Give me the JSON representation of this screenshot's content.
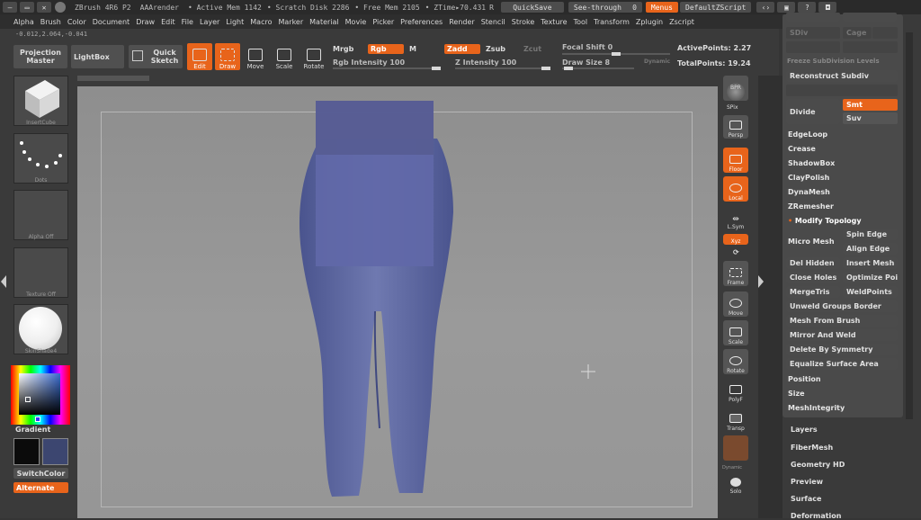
{
  "titlebar": {
    "app": "ZBrush 4R6 P2",
    "doc": "AAArender",
    "active_mem": "• Active Mem 1142",
    "scratch": "• Scratch Disk 2286",
    "free_mem": "• Free Mem 2105",
    "ztime": "• ZTime▸70.431",
    "rtime": "R",
    "quicksave": "QuickSave",
    "seethrough": "See-through",
    "seethrough_val": "0",
    "menus": "Menus",
    "script": "DefaultZScript"
  },
  "menubar": [
    "Alpha",
    "Brush",
    "Color",
    "Document",
    "Draw",
    "Edit",
    "File",
    "Layer",
    "Light",
    "Macro",
    "Marker",
    "Material",
    "Movie",
    "Picker",
    "Preferences",
    "Render",
    "Stencil",
    "Stroke",
    "Texture",
    "Tool",
    "Transform",
    "Zplugin",
    "Zscript"
  ],
  "coords": "-0.012,2.064,-0.041",
  "toolbar": {
    "projection_master": "Projection Master",
    "lightbox": "LightBox",
    "quick_sketch": "Quick Sketch",
    "edit": "Edit",
    "draw": "Draw",
    "move": "Move",
    "scale": "Scale",
    "rotate": "Rotate",
    "mrgb": "Mrgb",
    "rgb": "Rgb",
    "m": "M",
    "zadd": "Zadd",
    "zsub": "Zsub",
    "zcut": "Zcut",
    "rgb_intensity": "Rgb Intensity 100",
    "z_intensity": "Z Intensity 100",
    "focal_shift": "Focal Shift 0",
    "draw_size": "Draw Size 8",
    "dynamic": "Dynamic",
    "active_points": "ActivePoints: 2.27",
    "total_points": "TotalPoints: 19.24"
  },
  "left": {
    "insert_cube": "InsertCube",
    "dots": "Dots",
    "alpha_off": "Alpha Off",
    "texture_off": "Texture Off",
    "material": "SkinShade4",
    "gradient": "Gradient",
    "switch_color": "SwitchColor",
    "alternate": "Alternate",
    "primary_color": "#0b0b0b",
    "secondary_color": "#3c4670"
  },
  "right_strip": {
    "bpr": "BPR",
    "spix": "SPix",
    "persp": "Persp",
    "floor": "Floor",
    "local": "Local",
    "lsym": "L.Sym",
    "xyz": "Xyz",
    "frame": "Frame",
    "move": "Move",
    "scale": "Scale",
    "rotate": "Rotate",
    "polyf": "PolyF",
    "transp": "Transp",
    "dynamic": "Dynamic",
    "solo": "Solo"
  },
  "rpanel": {
    "sdiv": "SDiv",
    "cage": "Cage",
    "freeze": "Freeze SubDivision Levels",
    "reconstruct": "Reconstruct Subdiv",
    "divide": "Divide",
    "smt": "Smt",
    "suv": "Suv",
    "edgeloop": "EdgeLoop",
    "crease": "Crease",
    "shadowbox": "ShadowBox",
    "claypolish": "ClayPolish",
    "dynamesh": "DynaMesh",
    "zremesher": "ZRemesher",
    "modify_topology": "Modify Topology",
    "spin_edge": "Spin Edge",
    "micro_mesh": "Micro Mesh",
    "align_edge": "Align Edge",
    "del_hidden": "Del Hidden",
    "insert_mesh": "Insert Mesh",
    "close_holes": "Close Holes",
    "optimize_points": "Optimize Points",
    "mergetris": "MergeTris",
    "weldpoints": "WeldPoints",
    "unweld": "Unweld Groups Border",
    "mesh_from_brush": "Mesh From Brush",
    "mirror_weld": "Mirror And Weld",
    "delete_symmetry": "Delete By Symmetry",
    "equalize": "Equalize Surface Area",
    "position": "Position",
    "size": "Size",
    "mesh_integrity": "MeshIntegrity"
  },
  "groups": [
    "Layers",
    "FiberMesh",
    "Geometry HD",
    "Preview",
    "Surface",
    "Deformation"
  ]
}
